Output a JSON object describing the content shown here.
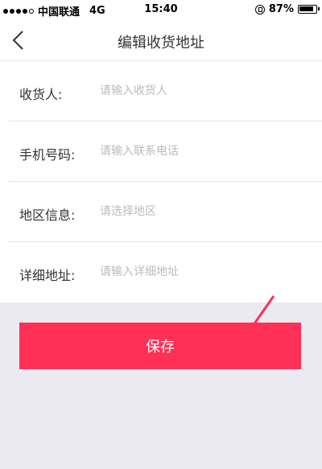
{
  "status_bar": {
    "carrier": "中国联通",
    "network": "4G",
    "time": "15:40",
    "battery": "87%",
    "battery_level": 0.87
  },
  "nav": {
    "title": "编辑收货地址",
    "back_icon": "chevron-left-icon"
  },
  "form": {
    "rows": [
      {
        "label": "收货人:",
        "placeholder": "请输入收货人"
      },
      {
        "label": "手机号码:",
        "placeholder": "请输入联系电话"
      },
      {
        "label": "地区信息:",
        "placeholder": "请选择地区"
      },
      {
        "label": "详细地址:",
        "placeholder": "请输入详细地址"
      }
    ]
  },
  "save_button": {
    "label": "保存"
  },
  "colors": {
    "accent": "#ff2f55",
    "background": "#ebeaf0",
    "placeholder": "#bbbbbb"
  }
}
